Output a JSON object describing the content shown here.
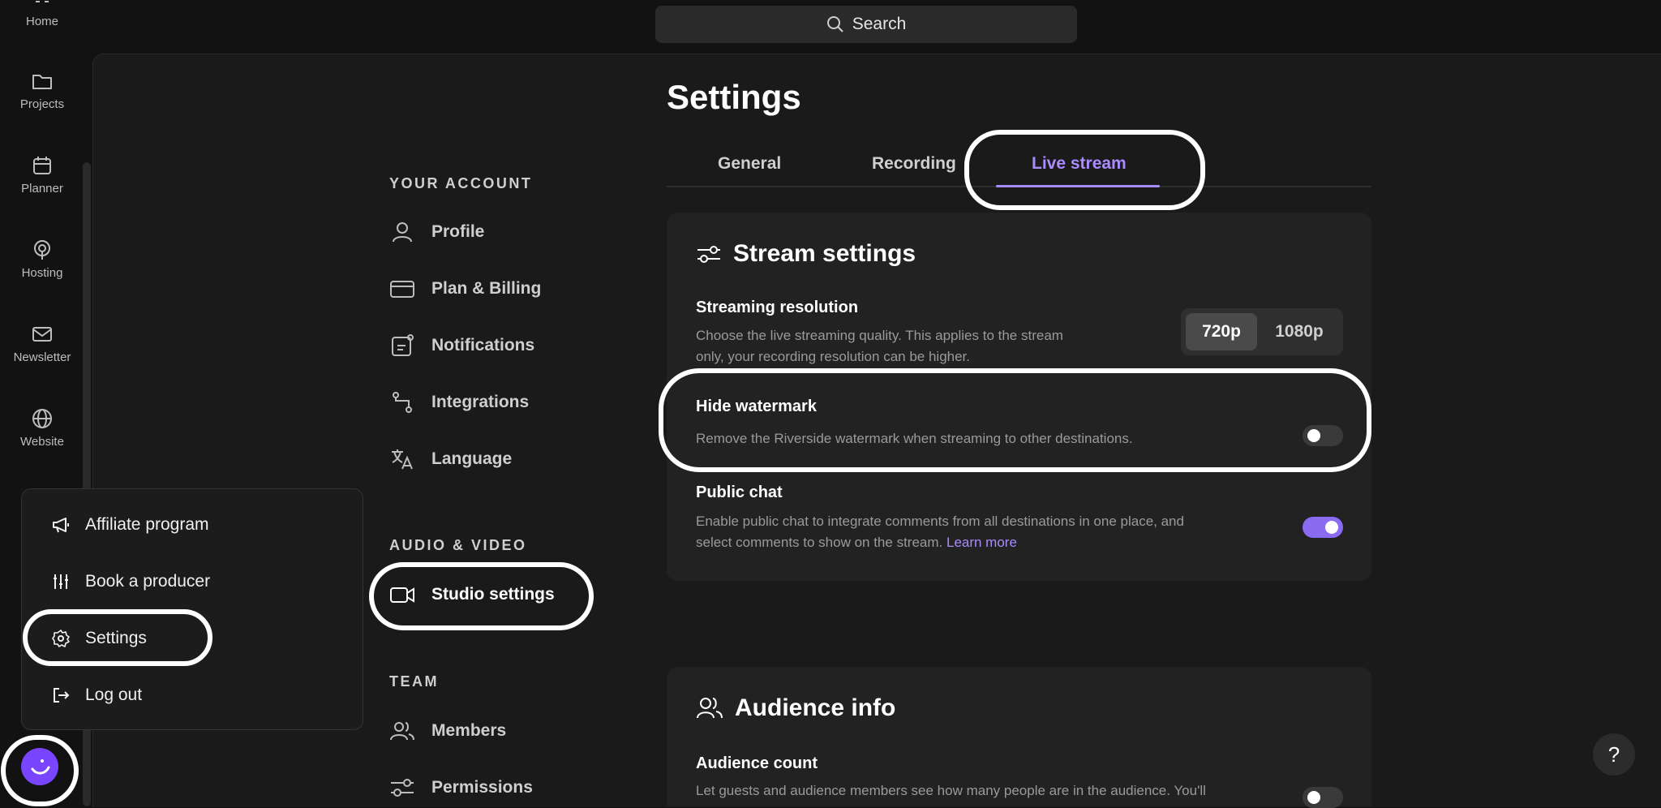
{
  "search": {
    "label": "Search"
  },
  "rail": {
    "items": [
      {
        "label": "Home"
      },
      {
        "label": "Projects"
      },
      {
        "label": "Planner"
      },
      {
        "label": "Hosting"
      },
      {
        "label": "Newsletter"
      },
      {
        "label": "Website"
      }
    ]
  },
  "settings_nav": {
    "your_account_heading": "YOUR ACCOUNT",
    "account_items": [
      {
        "label": "Profile"
      },
      {
        "label": "Plan & Billing"
      },
      {
        "label": "Notifications"
      },
      {
        "label": "Integrations"
      },
      {
        "label": "Language"
      }
    ],
    "audio_video_heading": "AUDIO & VIDEO",
    "audio_video_items": [
      {
        "label": "Studio settings"
      }
    ],
    "team_heading": "TEAM",
    "team_items": [
      {
        "label": "Members"
      },
      {
        "label": "Permissions"
      }
    ]
  },
  "main": {
    "title": "Settings",
    "tabs": [
      {
        "label": "General"
      },
      {
        "label": "Recording"
      },
      {
        "label": "Live stream",
        "active": true
      }
    ],
    "stream_settings": {
      "title": "Stream settings",
      "resolution": {
        "title": "Streaming resolution",
        "desc_line1": "Choose the live streaming quality. This applies to the stream",
        "desc_line2": "only, your recording resolution can be higher.",
        "options": [
          "720p",
          "1080p"
        ],
        "selected": "720p"
      },
      "watermark": {
        "title": "Hide watermark",
        "desc": "Remove the Riverside watermark when streaming to other destinations.",
        "enabled": false
      },
      "public_chat": {
        "title": "Public chat",
        "desc_line1": "Enable public chat to integrate comments from all destinations in one place, and",
        "desc_line2": "select comments to show on the stream.",
        "link": "Learn more",
        "enabled": true
      }
    },
    "audience_info": {
      "title": "Audience info",
      "count": {
        "title": "Audience count",
        "desc": "Let guests and audience members see how many people are in the audience. You'll",
        "enabled": false
      }
    }
  },
  "menu": {
    "items": [
      {
        "label": "Affiliate program"
      },
      {
        "label": "Book a producer"
      },
      {
        "label": "Settings"
      },
      {
        "label": "Log out"
      }
    ]
  },
  "help": {
    "label": "?"
  },
  "colors": {
    "accent": "#a98bff",
    "toggle_on": "#8b6bf2",
    "background": "#121212",
    "card": "#222222"
  }
}
